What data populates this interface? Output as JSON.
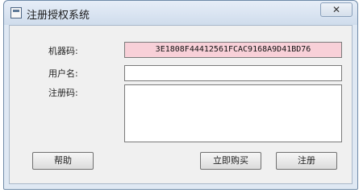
{
  "window": {
    "title": "注册授权系统",
    "close_glyph": "✕"
  },
  "form": {
    "machine_code_label": "机器码:",
    "machine_code_value": "3E1808F44412561FCAC9168A9D41BD76",
    "username_label": "用户名:",
    "username_value": "",
    "regcode_label": "注册码:",
    "regcode_value": ""
  },
  "buttons": {
    "help": "帮助",
    "buy": "立即购买",
    "register": "注册"
  }
}
